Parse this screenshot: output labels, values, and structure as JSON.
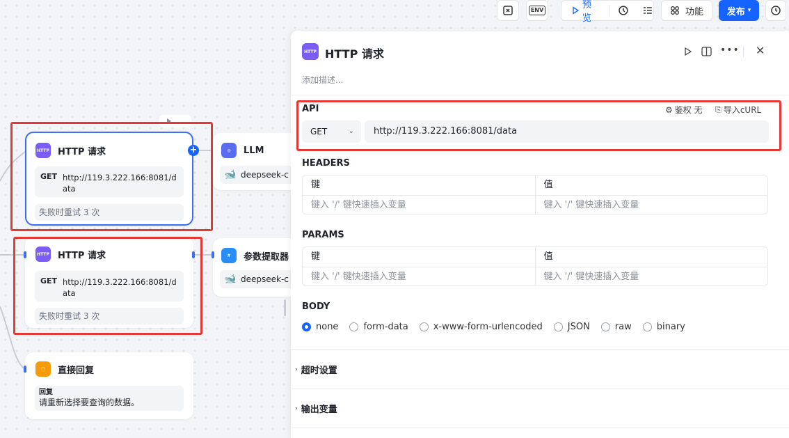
{
  "toolbar": {
    "preview_label": "预览",
    "features_label": "功能",
    "publish_label": "发布",
    "env_label": "ENV"
  },
  "canvas": {
    "nodes": [
      {
        "title": "HTTP 请求",
        "method": "GET",
        "url": "http://119.3.222.166:8081/data",
        "retry": "失败时重试 3 次"
      },
      {
        "title": "HTTP 请求",
        "method": "GET",
        "url": "http://119.3.222.166:8081/data",
        "retry": "失败时重试 3 次"
      },
      {
        "title": "LLM",
        "model": "deepseek-c"
      },
      {
        "title": "参数提取器",
        "model": "deepseek-c"
      },
      {
        "title": "直接回复",
        "reply_label": "回复",
        "reply_text": "请重新选择要查询的数据。"
      }
    ]
  },
  "panel": {
    "title": "HTTP 请求",
    "description_placeholder": "添加描述...",
    "api": {
      "label": "API",
      "auth_label": "鉴权 无",
      "import_label": "导入cURL",
      "method": "GET",
      "url": "http://119.3.222.166:8081/data"
    },
    "headers": {
      "label": "HEADERS",
      "key_header": "键",
      "value_header": "值",
      "key_placeholder": "键入 '/' 键快速插入变量",
      "value_placeholder": "键入 '/' 键快速插入变量"
    },
    "params": {
      "label": "PARAMS",
      "key_header": "键",
      "value_header": "值",
      "key_placeholder": "键入 '/' 键快速插入变量",
      "value_placeholder": "键入 '/' 键快速插入变量"
    },
    "body": {
      "label": "BODY",
      "options": [
        "none",
        "form-data",
        "x-www-form-urlencoded",
        "JSON",
        "raw",
        "binary"
      ],
      "selected": "none"
    },
    "timeout_label": "超时设置",
    "output_label": "输出变量"
  },
  "colors": {
    "accent": "#1664ff",
    "highlight": "#e53935"
  }
}
